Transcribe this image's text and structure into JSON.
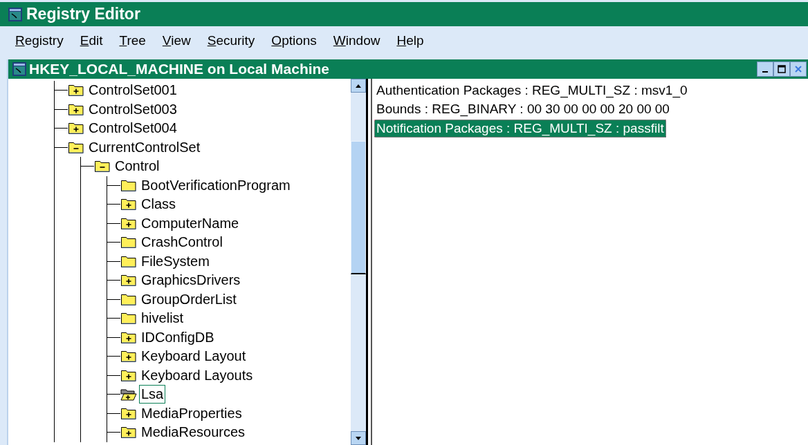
{
  "window": {
    "title": "Registry Editor"
  },
  "menu": [
    "Registry",
    "Edit",
    "Tree",
    "View",
    "Security",
    "Options",
    "Window",
    "Help"
  ],
  "child_window": {
    "title": "HKEY_LOCAL_MACHINE on Local Machine"
  },
  "tree": [
    {
      "label": "ControlSet001",
      "kind": "collapsed",
      "selected": false
    },
    {
      "label": "ControlSet003",
      "kind": "collapsed",
      "selected": false
    },
    {
      "label": "ControlSet004",
      "kind": "collapsed",
      "selected": false
    },
    {
      "label": "CurrentControlSet",
      "kind": "expanded",
      "selected": false,
      "children": [
        {
          "label": "Control",
          "kind": "expanded",
          "selected": false,
          "children": [
            {
              "label": "BootVerificationProgram",
              "kind": "leaf",
              "selected": false
            },
            {
              "label": "Class",
              "kind": "collapsed",
              "selected": false
            },
            {
              "label": "ComputerName",
              "kind": "collapsed",
              "selected": false
            },
            {
              "label": "CrashControl",
              "kind": "leaf",
              "selected": false
            },
            {
              "label": "FileSystem",
              "kind": "leaf",
              "selected": false
            },
            {
              "label": "GraphicsDrivers",
              "kind": "collapsed",
              "selected": false
            },
            {
              "label": "GroupOrderList",
              "kind": "leaf",
              "selected": false
            },
            {
              "label": "hivelist",
              "kind": "leaf",
              "selected": false
            },
            {
              "label": "IDConfigDB",
              "kind": "collapsed",
              "selected": false
            },
            {
              "label": "Keyboard Layout",
              "kind": "collapsed",
              "selected": false
            },
            {
              "label": "Keyboard Layouts",
              "kind": "collapsed",
              "selected": false
            },
            {
              "label": "Lsa",
              "kind": "open",
              "selected": true
            },
            {
              "label": "MediaProperties",
              "kind": "collapsed",
              "selected": false
            },
            {
              "label": "MediaResources",
              "kind": "collapsed",
              "selected": false
            }
          ]
        }
      ]
    }
  ],
  "values": [
    {
      "text": "Authentication Packages : REG_MULTI_SZ : msv1_0",
      "selected": false
    },
    {
      "text": "Bounds : REG_BINARY : 00 30 00 00 00 20 00 00",
      "selected": false
    },
    {
      "text": "Notification Packages : REG_MULTI_SZ : passfilt",
      "selected": true
    }
  ]
}
